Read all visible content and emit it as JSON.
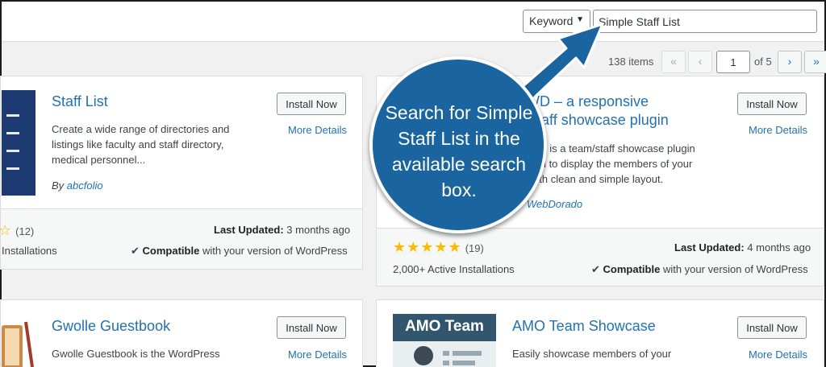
{
  "search": {
    "filter_value": "Keyword",
    "query": "Simple Staff List"
  },
  "pagination": {
    "items_count": "138 items",
    "first": "«",
    "prev": "‹",
    "current_page": "1",
    "of_total": "of 5",
    "next": "›",
    "last": "»"
  },
  "callout": {
    "text": "Search for Simple Staff List in the available search box."
  },
  "plugins": [
    {
      "name": "Staff List",
      "description": "Create a wide range of directories and listings like faculty and staff directory, medical personnel...",
      "author_prefix": "By ",
      "author": "abcfolio",
      "install_label": "Install Now",
      "details_label": "More Details",
      "rating_count": "(12)",
      "installs": "Installations",
      "last_updated_label": "Last Updated:",
      "last_updated_value": "3 months ago",
      "compat_label": "Compatible",
      "compat_rest": "with your version of WordPress"
    },
    {
      "name": "m WD – a responsive",
      "name_line2": "/staff showcase plugin",
      "description_lines": [
        "WD is a team/staff showcase plugin",
        "you to display the members of your",
        "with clean and simple layout."
      ],
      "author": "WebDorado",
      "install_label": "Install Now",
      "details_label": "More Details",
      "rating_count": "(19)",
      "installs": "2,000+ Active Installations",
      "last_updated_label": "Last Updated:",
      "last_updated_value": "4 months ago",
      "compat_label": "Compatible",
      "compat_rest": "with your version of WordPress"
    },
    {
      "name": "Gwolle Guestbook",
      "description": "Gwolle Guestbook is the WordPress",
      "install_label": "Install Now",
      "details_label": "More Details"
    },
    {
      "name": "AMO Team Showcase",
      "thumb_label": "AMO Team",
      "description": "Easily showcase members of your",
      "install_label": "Install Now",
      "details_label": "More Details"
    }
  ],
  "colors": {
    "link": "#2271b1",
    "star": "#ffb900",
    "callout": "#1a64a0"
  },
  "icons": {
    "dropdown": "chevron-down-icon",
    "compat": "checkmark-icon",
    "star": "star-icon"
  }
}
